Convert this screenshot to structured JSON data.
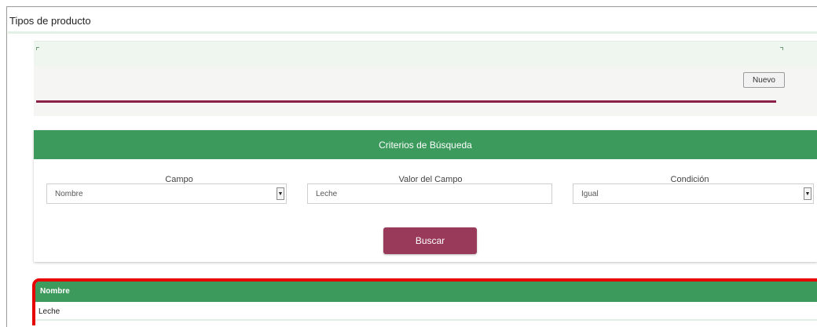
{
  "page": {
    "title": "Tipos de producto"
  },
  "toolbar": {
    "new_label": "Nuevo"
  },
  "search": {
    "header": "Criterios de Búsqueda",
    "campo_label": "Campo",
    "campo_value": "Nombre",
    "valor_label": "Valor del Campo",
    "valor_value": "Leche",
    "condicion_label": "Condición",
    "condicion_value": "Igual",
    "button_label": "Buscar"
  },
  "results": {
    "columns": [
      "Nombre"
    ],
    "rows": [
      [
        "Leche"
      ]
    ]
  },
  "colors": {
    "green": "#3b9a5c",
    "accent": "#8d2049",
    "button": "#9a3a5a",
    "highlight": "#e60000"
  },
  "icons": {
    "select_arrow": "caret-down-icon"
  }
}
